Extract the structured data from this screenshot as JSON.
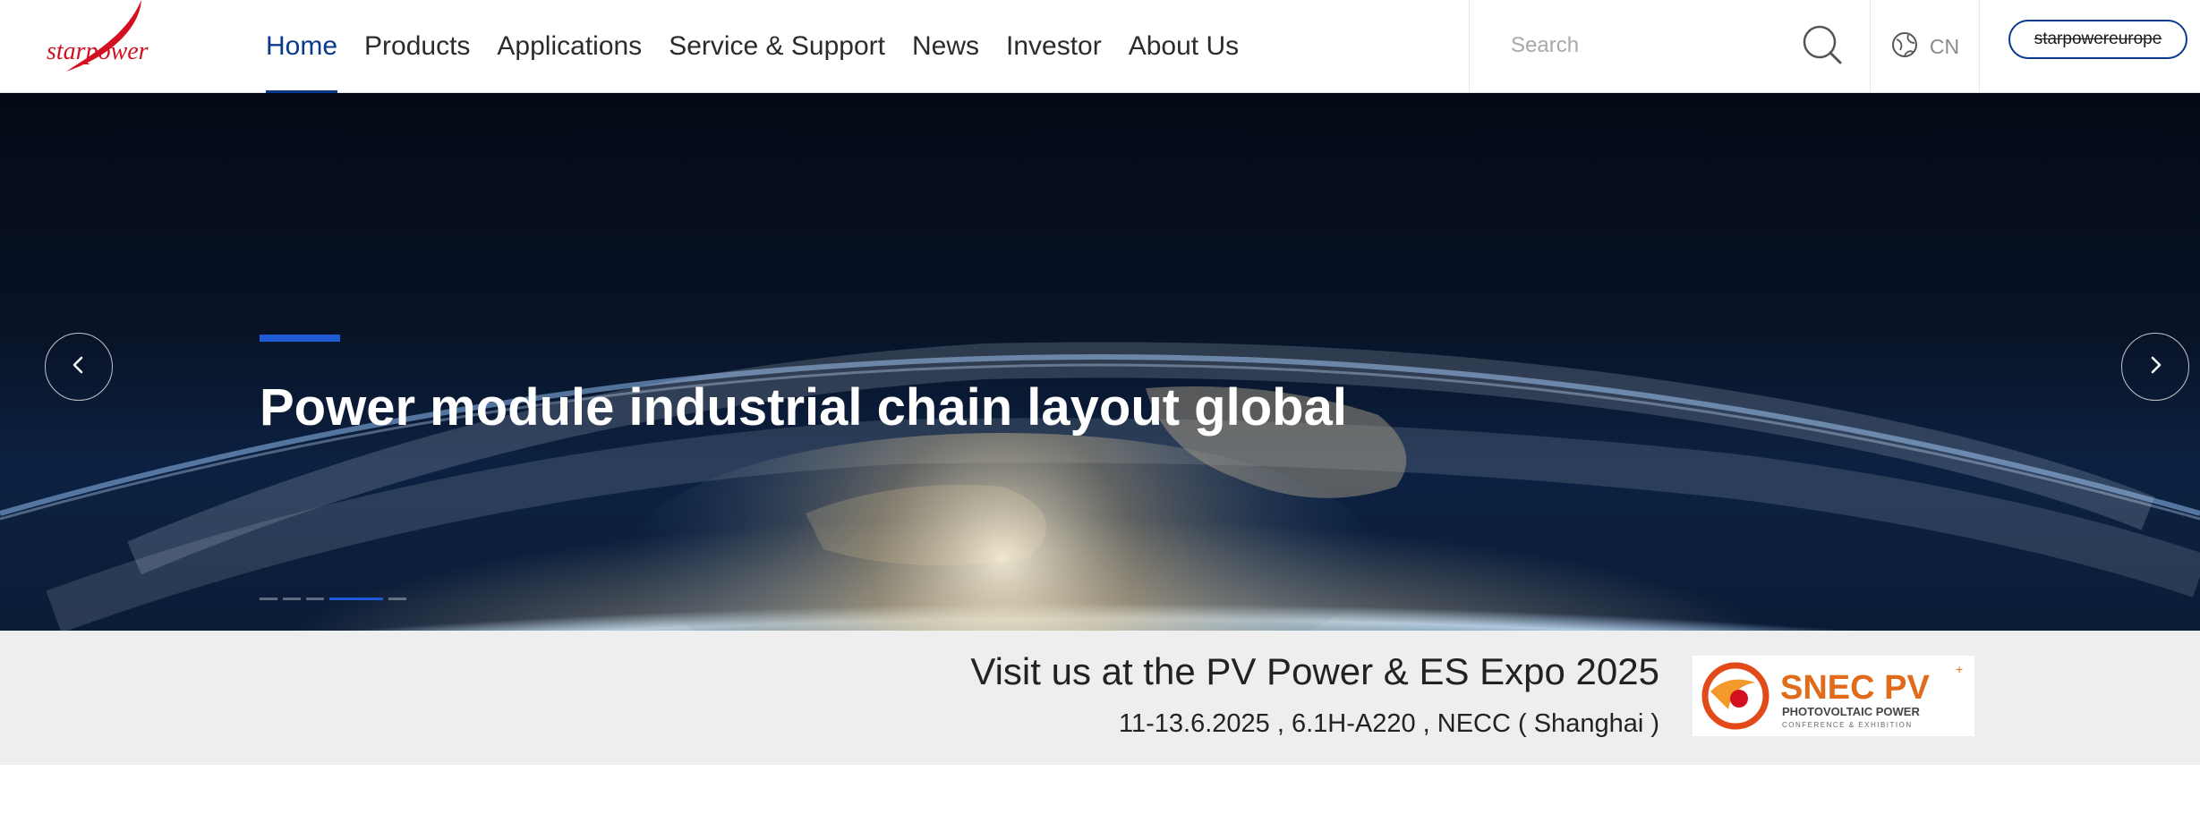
{
  "header": {
    "logo_text": "starpower",
    "nav": [
      {
        "label": "Home",
        "active": true
      },
      {
        "label": "Products"
      },
      {
        "label": "Applications"
      },
      {
        "label": "Service & Support"
      },
      {
        "label": "News"
      },
      {
        "label": "Investor"
      },
      {
        "label": "About Us"
      }
    ],
    "search_placeholder": "Search",
    "search_icon": "search-icon",
    "lang_icon": "globe-icon",
    "lang_label": "CN",
    "europe_button": "starpowereurope"
  },
  "hero": {
    "title": "Power module industrial chain layout global",
    "prev_icon": "chevron-left-icon",
    "next_icon": "chevron-right-icon",
    "slides_total": 5,
    "active_slide": 4
  },
  "banner": {
    "title": "Visit us at the PV Power & ES Expo 2025",
    "subtitle": "11-13.6.2025 , 6.1H-A220 , NECC ( Shanghai )",
    "logo_brand": "SNEC PV",
    "logo_sub1": "PHOTOVOLTAIC POWER",
    "logo_sub2": "CONFERENCE & EXHIBITION"
  },
  "colors": {
    "brand_red": "#d3101f",
    "accent_blue": "#0a3a8c",
    "slide_blue": "#1f5bd6",
    "snec_orange": "#e06b1a"
  }
}
